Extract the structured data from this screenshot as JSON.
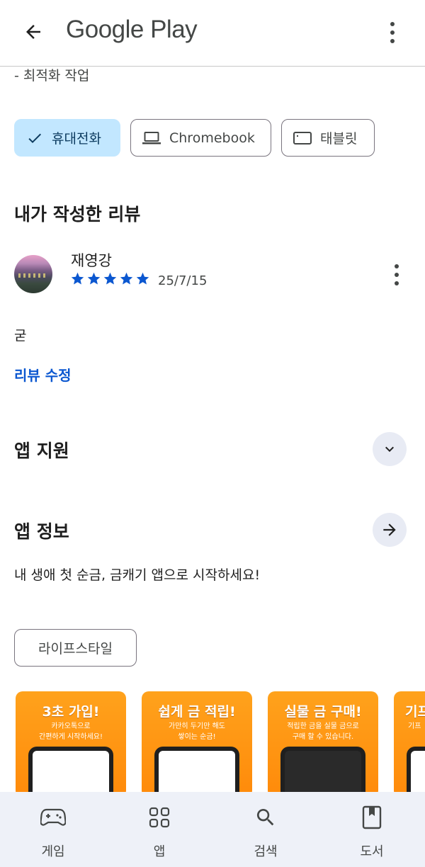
{
  "header": {
    "brand": "Google Play",
    "back_icon": "arrow-back-icon",
    "more_icon": "more-vert-icon"
  },
  "whats_new_tail": "- 최적화 작업",
  "device_chips": [
    {
      "label": "휴대전화",
      "icon": "check-icon",
      "selected": true
    },
    {
      "label": "Chromebook",
      "icon": "laptop-icon",
      "selected": false
    },
    {
      "label": "태블릿",
      "icon": "tablet-icon",
      "selected": false
    }
  ],
  "my_review": {
    "heading": "내가 작성한 리뷰",
    "reviewer_name": "재영강",
    "rating": 5,
    "date": "25/7/15",
    "text": "굳",
    "edit_label": "리뷰 수정"
  },
  "app_support": {
    "heading": "앱 지원",
    "icon": "expand-more-icon"
  },
  "app_info": {
    "heading": "앱 정보",
    "icon": "arrow-forward-icon",
    "description": "내 생애 첫 순금, 금캐기 앱으로 시작하세요!",
    "category": "라이프스타일"
  },
  "screenshots": [
    {
      "title": "3초 가입!",
      "subtitle_1": "카카오톡으로",
      "subtitle_2": "간편하게 시작하세요!"
    },
    {
      "title": "쉽게 금 적립!",
      "subtitle_1": "가만히 두기만 해도",
      "subtitle_2": "쌓이는 순금!"
    },
    {
      "title": "실물 금 구매!",
      "subtitle_1": "적립한 금을 실물 금으로",
      "subtitle_2": "구매 할 수 있습니다."
    },
    {
      "title": "기프",
      "subtitle_1": "",
      "subtitle_2": "기프"
    }
  ],
  "bottom_nav": [
    {
      "label": "게임",
      "icon": "gamepad-icon"
    },
    {
      "label": "앱",
      "icon": "apps-grid-icon"
    },
    {
      "label": "검색",
      "icon": "search-icon"
    },
    {
      "label": "도서",
      "icon": "book-icon"
    }
  ],
  "colors": {
    "accent_blue": "#0b57d0",
    "chip_selected": "#c2e7ff",
    "star": "#0b57d0",
    "nav_bg": "#eef1f8",
    "screenshot_orange": "#ff9a14"
  }
}
